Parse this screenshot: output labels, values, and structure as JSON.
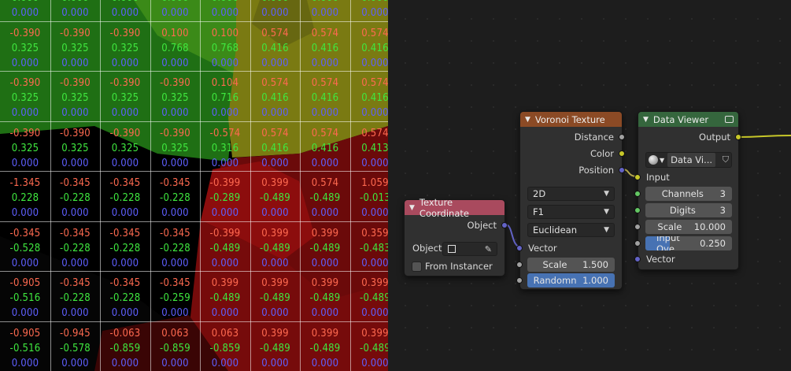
{
  "viewport": {
    "grid": [
      [
        "0.000|0.000|0.000",
        "0.000|0.000|0.000",
        "0.000|0.000|0.000",
        "0.000|0.000|0.000",
        "0.000|0.000|0.000",
        "0.000|0.000|0.000",
        "0.000|0.000|0.000",
        "0.000|0.000|0.000"
      ],
      [
        "-0.390|0.325|0.000",
        "-0.390|0.325|0.000",
        "-0.390|0.325|0.000",
        "0.100|0.768|0.000",
        "0.100|0.768|0.000",
        "0.574|0.416|0.000",
        "0.574|0.416|0.000",
        "0.574|0.416|0.000"
      ],
      [
        "-0.390|0.325|0.000",
        "-0.390|0.325|0.000",
        "-0.390|0.325|0.000",
        "-0.390|0.325|0.000",
        "0.104|0.716|0.000",
        "0.574|0.416|0.000",
        "0.574|0.416|0.000",
        "0.574|0.416|0.000"
      ],
      [
        "-0.390|0.325|0.000",
        "-0.390|0.325|0.000",
        "-0.390|0.325|0.000",
        "-0.390|0.325|0.000",
        "-0.574|0.316|0.000",
        "0.574|0.416|0.000",
        "0.574|0.416|0.000",
        "0.574|0.413|0.000"
      ],
      [
        "-1.345|0.228|0.000",
        "-0.345|-0.228|0.000",
        "-0.345|-0.228|0.000",
        "-0.345|-0.228|0.000",
        "-0.399|-0.289|0.000",
        "0.399|-0.489|0.000",
        "0.574|-0.489|0.000",
        "1.059|-0.013|0.000"
      ],
      [
        "-0.345|-0.528|0.000",
        "-0.345|-0.228|0.000",
        "-0.345|-0.228|0.000",
        "-0.345|-0.228|0.000",
        "-0.399|-0.489|0.000",
        "0.399|-0.489|0.000",
        "0.399|-0.489|0.000",
        "0.359|-0.483|0.000"
      ],
      [
        "-0.905|-0.516|0.000",
        "-0.345|-0.228|0.000",
        "-0.345|-0.228|0.000",
        "-0.345|-0.259|0.000",
        "0.399|-0.489|0.000",
        "0.399|-0.489|0.000",
        "0.399|-0.489|0.000",
        "0.399|-0.489|0.000"
      ],
      [
        "-0.905|-0.516|0.000",
        "-0.945|-0.578|0.000",
        "-0.063|-0.859|0.000",
        "0.063|-0.859|0.000",
        "0.063|-0.859|0.000",
        "0.399|-0.489|0.000",
        "0.399|-0.489|0.000",
        "0.399|-0.489|0.000"
      ]
    ],
    "colors": {
      "red_text": "#ff6a50",
      "green_text": "#3fe83f",
      "blue_text": "#5f5fff"
    }
  },
  "nodes": {
    "texture_coordinate": {
      "title": "Texture Coordinate",
      "header_color": "#a94a5e",
      "output_object": "Object",
      "object_label": "Object:",
      "from_instancer": "From Instancer"
    },
    "voronoi": {
      "title": "Voronoi Texture",
      "header_color": "#8b4a25",
      "outputs": [
        "Distance",
        "Color",
        "Position"
      ],
      "dimension": "2D",
      "feature": "F1",
      "metric": "Euclidean",
      "vector_label": "Vector",
      "scale_label": "Scale",
      "scale_value": "1.500",
      "randomness_label": "Randomn",
      "randomness_value": "1.000"
    },
    "data_viewer": {
      "title": "Data Viewer",
      "header_color": "#35663d",
      "output_label": "Output",
      "datablock_name": "Data Vi...",
      "input_label": "Input",
      "channels_label": "Channels",
      "channels_value": "3",
      "digits_label": "Digits",
      "digits_value": "3",
      "scale_label": "Scale",
      "scale_value": "10.000",
      "input_overlay_label": "Input Ove",
      "input_overlay_value": "0.250",
      "vector_label": "Vector"
    }
  },
  "socket_colors": {
    "float": "#a1a1a1",
    "color": "#c7c729",
    "vector": "#6363c7",
    "int": "#63c763"
  }
}
